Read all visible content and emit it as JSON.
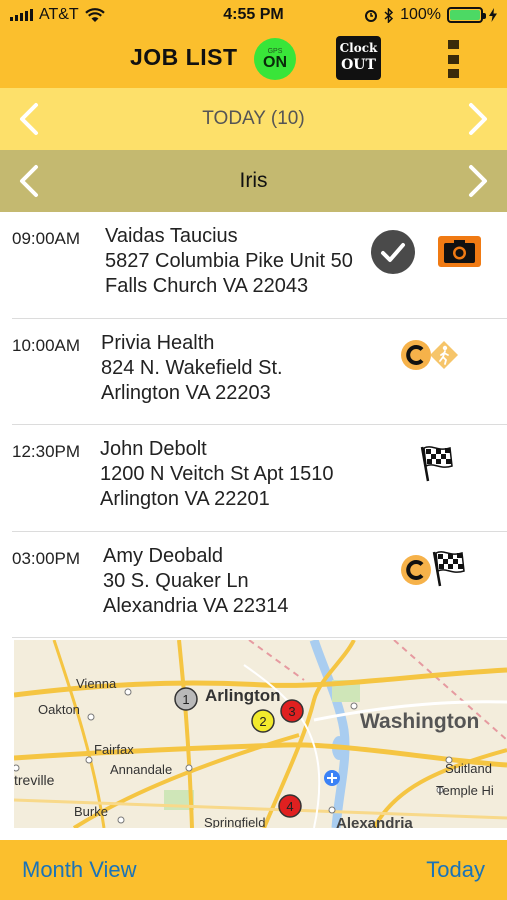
{
  "status": {
    "carrier": "AT&T",
    "time": "4:55 PM",
    "battery": "100%",
    "battery_level": 1.0
  },
  "header": {
    "title": "JOB LIST",
    "gps_label": "GPS",
    "gps_state": "ON",
    "clock_line1": "Clock",
    "clock_line2": "OUT",
    "menu_icon": "kebab-menu-icon"
  },
  "date_nav": {
    "label": "TODAY (10)",
    "prev_icon": "chevron-left-icon",
    "next_icon": "chevron-right-icon"
  },
  "worker_nav": {
    "label": "Iris",
    "prev_icon": "chevron-left-icon",
    "next_icon": "chevron-right-icon"
  },
  "jobs": [
    {
      "time": "09:00AM",
      "name": "Vaidas Taucius",
      "address1": "5827 Columbia Pike Unit 50",
      "address2": "Falls Church VA 22043",
      "icons": [
        "completed-check-icon",
        "camera-icon"
      ]
    },
    {
      "time": "10:00AM",
      "name": "Privia Health",
      "address1": "824 N. Wakefield St.",
      "address2": "Arlington VA 22203",
      "icons": [
        "clock-in-c-icon",
        "walking-person-icon"
      ]
    },
    {
      "time": "12:30PM",
      "name": "John Debolt",
      "address1": "1200 N Veitch St Apt 1510",
      "address2": "Arlington VA 22201",
      "icons": [
        "checkered-flag-icon"
      ]
    },
    {
      "time": "03:00PM",
      "name": "Amy Deobald",
      "address1": "30 S. Quaker Ln",
      "address2": "Alexandria VA 22314",
      "icons": [
        "clock-in-c-icon",
        "checkered-flag-icon"
      ]
    }
  ],
  "map": {
    "labels": [
      "Vienna",
      "Oakton",
      "Arlington",
      "Washington",
      "Fairfax",
      "Annandale",
      "treville",
      "Suitland",
      "Temple Hi",
      "Burke",
      "Springfield",
      "Alexandria"
    ],
    "markers": [
      {
        "number": "1",
        "color": "#b9b9b9"
      },
      {
        "number": "2",
        "color": "#f2ea2c"
      },
      {
        "number": "3",
        "color": "#e02020"
      },
      {
        "number": "4",
        "color": "#e02020"
      }
    ]
  },
  "footer": {
    "left_label": "Month View",
    "right_label": "Today"
  },
  "colors": {
    "header_bg": "#fbbf2d",
    "date_bar_bg": "#fde06a",
    "worker_bar_bg": "#c4b970",
    "link_blue": "#1a73b8"
  }
}
